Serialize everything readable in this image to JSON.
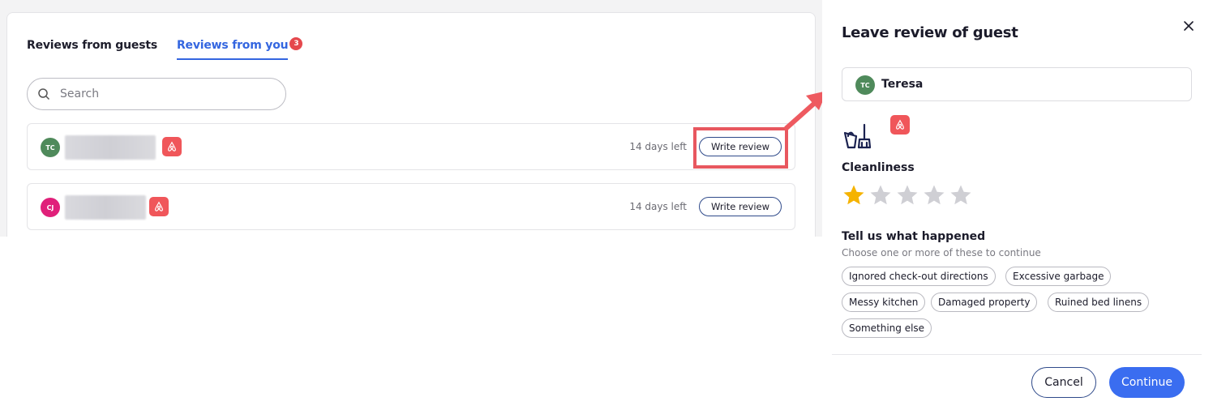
{
  "tabs": {
    "guests_label": "Reviews from guests",
    "you_label": "Reviews from you",
    "you_badge": "3"
  },
  "search": {
    "placeholder": "Search"
  },
  "rows": [
    {
      "initials": "TC",
      "avatar_color": "#4f8a5b",
      "days_left": "14 days left",
      "action_label": "Write review"
    },
    {
      "initials": "CJ",
      "avatar_color": "#e0207a",
      "days_left": "14 days left",
      "action_label": "Write review"
    }
  ],
  "panel": {
    "title": "Leave review of guest",
    "guest_initials": "TC",
    "guest_name": "Teresa",
    "category_label": "Cleanliness",
    "rating": {
      "value": 1,
      "max": 5
    },
    "tell_title": "Tell us what happened",
    "tell_subtitle": "Choose one or more of these to continue",
    "chips": [
      "Ignored check-out directions",
      "Excessive garbage",
      "Messy kitchen",
      "Damaged property",
      "Ruined bed linens",
      "Something else"
    ],
    "cancel_label": "Cancel",
    "continue_label": "Continue"
  },
  "colors": {
    "accent": "#3466e0",
    "airbnb": "#f0565a",
    "highlight": "#e8575f",
    "star_filled": "#f5b301",
    "star_empty": "#cfcfd4"
  }
}
